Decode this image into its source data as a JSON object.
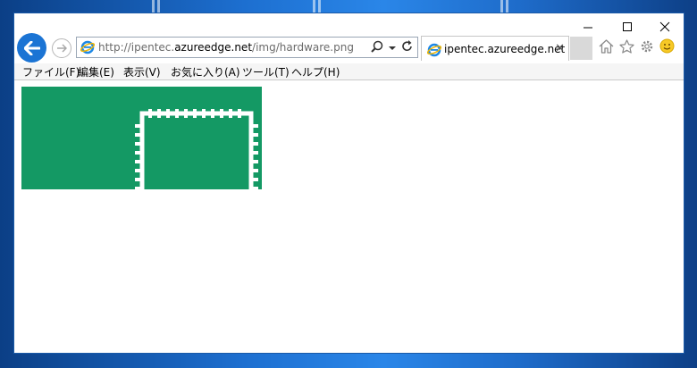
{
  "window": {
    "controls": {
      "minimize": "—",
      "maximize": "☐",
      "close": "✕"
    }
  },
  "address_bar": {
    "url_prefix": "http://ipentec.",
    "url_domain": "azureedge.net",
    "url_path": "/img/hardware.png"
  },
  "tab": {
    "title": "ipentec.azureedge.net",
    "close": "✕"
  },
  "menubar": {
    "items": [
      "ファイル(F)",
      "編集(E)",
      "表示(V)",
      "お気に入り(A)",
      "ツール(T)",
      "ヘルプ(H)"
    ]
  },
  "colors": {
    "image_green": "#149964",
    "back_button": "#1b74d4"
  }
}
